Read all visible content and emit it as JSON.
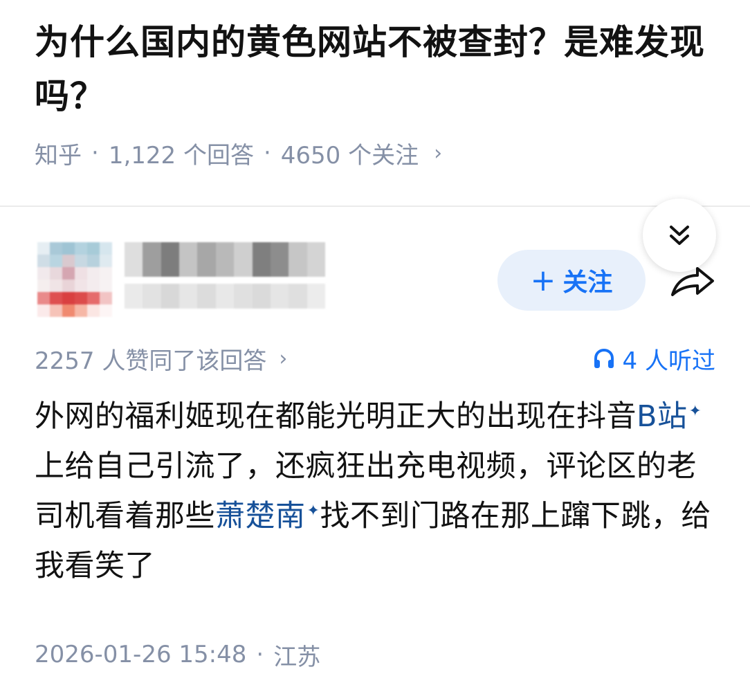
{
  "question": {
    "title": "为什么国内的黄色网站不被查封？是难发现吗？"
  },
  "meta": {
    "source": "知乎",
    "separator": "·",
    "answers": "1,122 个回答",
    "followers": "4650 个关注",
    "chevron": "›"
  },
  "author": {
    "follow_plus": "+",
    "follow_label": "关注"
  },
  "stats": {
    "upvotes": "2257 人赞同了该回答",
    "chevron": "›",
    "listeners": "4 人听过"
  },
  "answer": {
    "part1": "外网的福利姬现在都能光明正大的出现在抖音",
    "link1": "B站",
    "link_mark": "✦",
    "part2": "上给自己引流了，还疯狂出充电视频，评论区的老司机看着那些",
    "link2": "萧楚南",
    "part3": "找不到门路在那上蹿下跳，给我看笑了"
  },
  "footer": {
    "date": "2026-01-26 15:48",
    "separator": "·",
    "location": "江苏"
  },
  "colors": {
    "accent": "#1772f6",
    "link": "#175199",
    "muted": "#8590a6",
    "follow_bg": "#e8f0fb"
  },
  "icons": {
    "collapse": "double-chevron-down-icon",
    "share": "share-arrow-icon",
    "listen": "headphones-icon"
  }
}
